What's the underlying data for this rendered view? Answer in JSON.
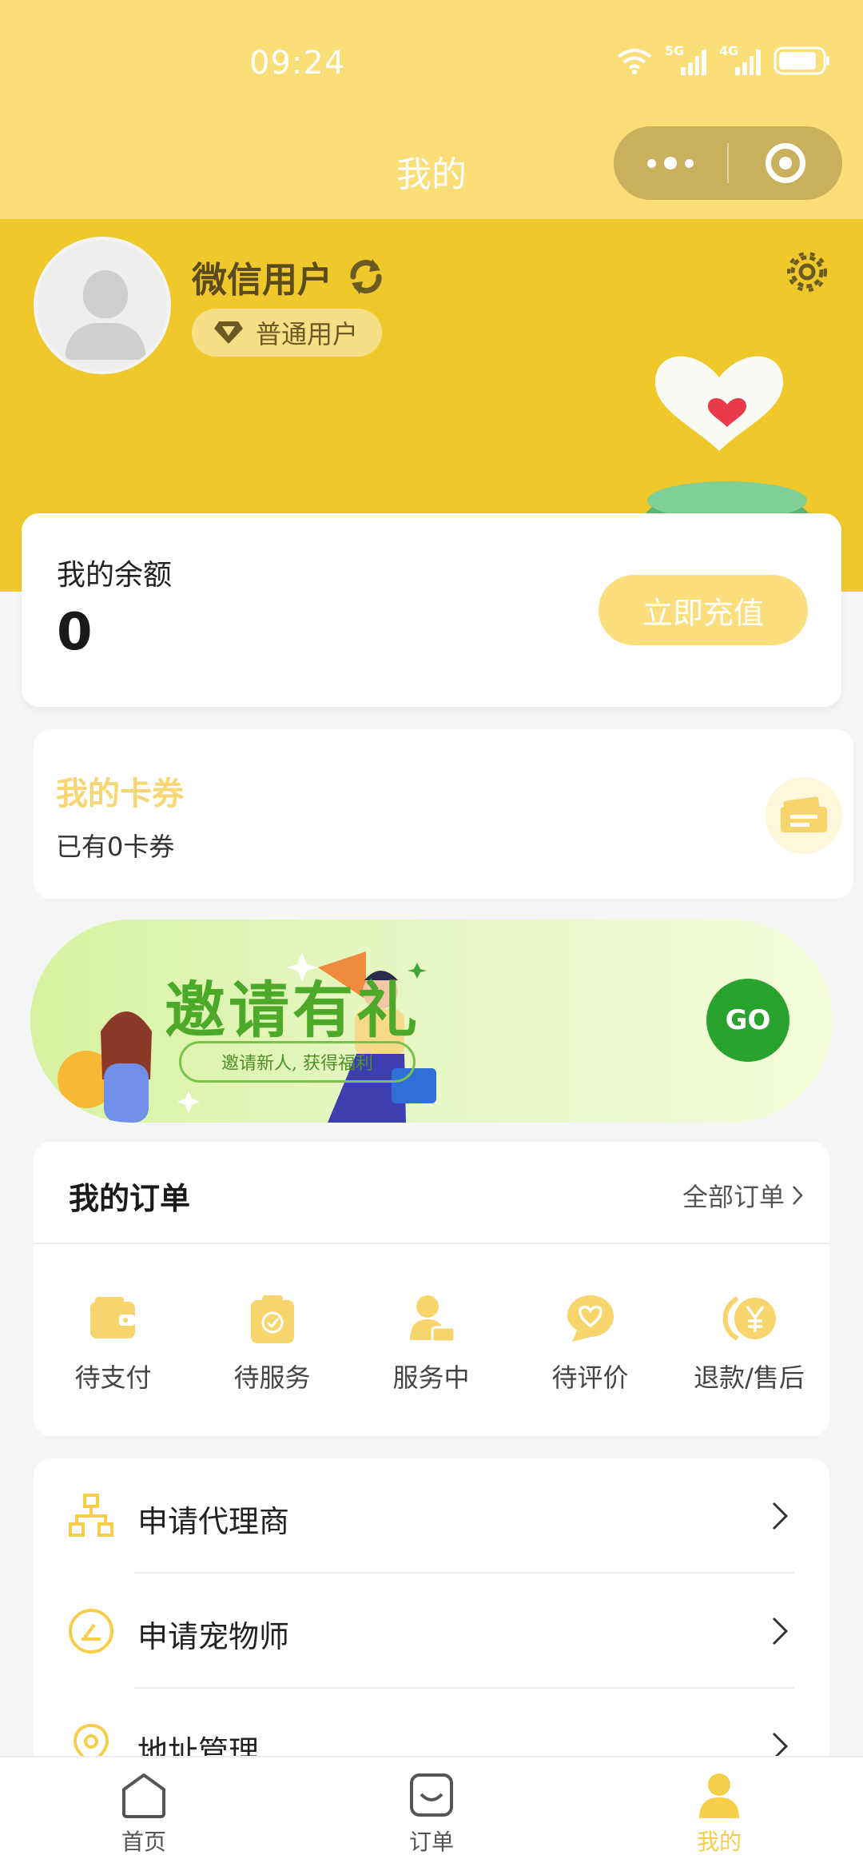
{
  "status_bar": {
    "time": "09:24",
    "signal1": "5G",
    "signal2": "4G"
  },
  "nav": {
    "title": "我的"
  },
  "profile": {
    "name": "微信用户",
    "level": "普通用户"
  },
  "balance": {
    "label": "我的余额",
    "value": "0",
    "button": "立即充值"
  },
  "coupons": {
    "title": "我的卡券",
    "subtitle": "已有0卡券"
  },
  "invite": {
    "title": "邀请有礼",
    "subtitle": "邀请新人, 获得福利",
    "button": "GO"
  },
  "orders": {
    "title": "我的订单",
    "all_link": "全部订单",
    "items": [
      {
        "label": "待支付",
        "icon": "wallet-icon"
      },
      {
        "label": "待服务",
        "icon": "clipboard-check-icon"
      },
      {
        "label": "服务中",
        "icon": "person-service-icon"
      },
      {
        "label": "待评价",
        "icon": "heart-chat-icon"
      },
      {
        "label": "退款/售后",
        "icon": "yen-refund-icon"
      }
    ]
  },
  "menu": {
    "items": [
      {
        "label": "申请代理商",
        "icon": "org-chart-icon"
      },
      {
        "label": "申请宠物师",
        "icon": "gauge-icon"
      },
      {
        "label": "地址管理",
        "icon": "location-pin-icon"
      }
    ]
  },
  "tabbar": {
    "items": [
      {
        "label": "首页",
        "icon": "home-icon"
      },
      {
        "label": "订单",
        "icon": "order-bag-icon"
      },
      {
        "label": "我的",
        "icon": "person-icon",
        "active": true
      }
    ]
  },
  "colors": {
    "header_yellow": "#fade78",
    "banner_yellow": "#efc92c",
    "accent_yellow": "#f5cf4a",
    "go_green": "#29a32e"
  }
}
